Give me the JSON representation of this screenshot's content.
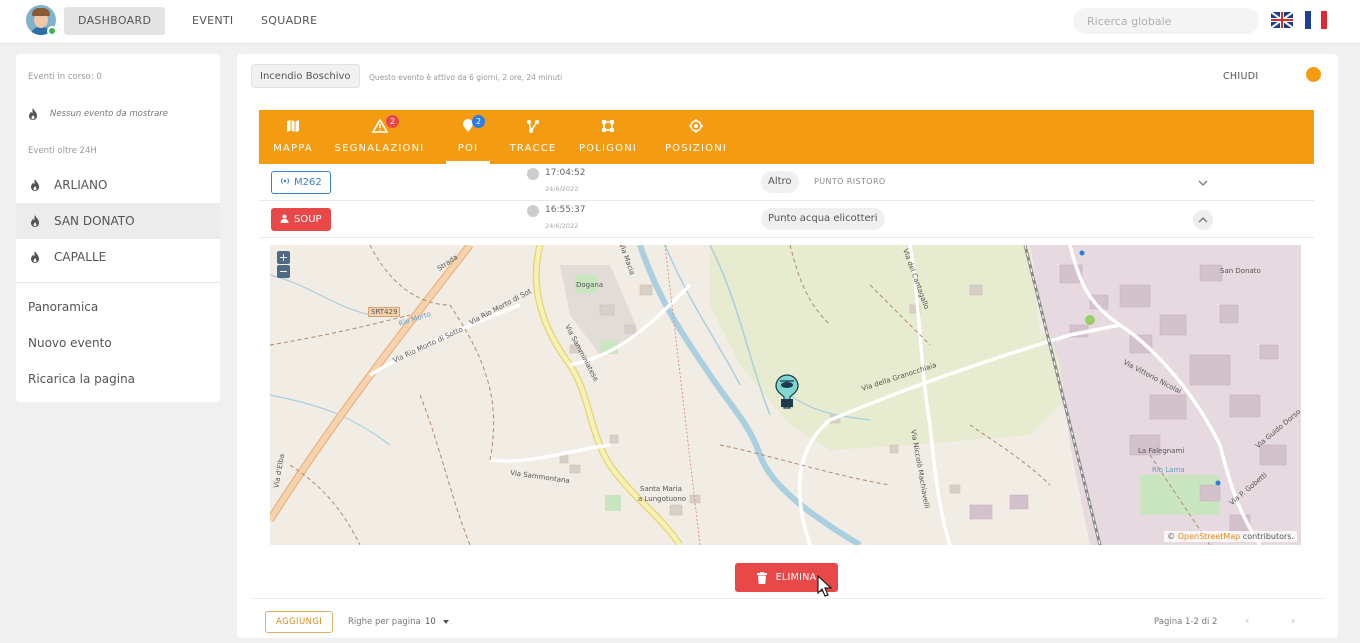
{
  "topnav": {
    "items": [
      {
        "label": "DASHBOARD"
      },
      {
        "label": "EVENTI"
      },
      {
        "label": "SQUADRE"
      }
    ],
    "search_placeholder": "Ricerca globale",
    "languages": [
      "en",
      "fr"
    ]
  },
  "sidebar": {
    "in_progress": "Eventi in corso: 0",
    "no_events": "Nessun evento da mostrare",
    "over_24h": "Eventi oltre 24H",
    "events": [
      {
        "label": "ARLIANO"
      },
      {
        "label": "SAN DONATO"
      },
      {
        "label": "CAPALLE"
      }
    ],
    "links": [
      {
        "label": "Panoramica"
      },
      {
        "label": "Nuovo evento"
      },
      {
        "label": "Ricarica la pagina"
      }
    ]
  },
  "event": {
    "name": "Incendio Boschivo",
    "status": "Questo evento è attivo da 6 giorni, 2 ore, 24 minuti",
    "close_label": "CHIUDI",
    "status_color": "#f39c12"
  },
  "tabs": [
    {
      "label": "MAPPA",
      "icon": "map-icon"
    },
    {
      "label": "SEGNALAZIONI",
      "icon": "warning-icon",
      "badge": "2"
    },
    {
      "label": "POI",
      "icon": "poi-pin-icon",
      "badge": "2"
    },
    {
      "label": "TRACCE",
      "icon": "tracks-icon"
    },
    {
      "label": "POLIGONI",
      "icon": "polygon-icon"
    },
    {
      "label": "POSIZIONI",
      "icon": "target-icon"
    }
  ],
  "poi_rows": [
    {
      "code": "M262",
      "time": "17:04:52",
      "date": "24/6/2022",
      "type": "Altro",
      "subtype": "PUNTO RISTORO",
      "expanded": false
    },
    {
      "code": "SOUP",
      "time": "16:55:37",
      "date": "24/6/2022",
      "type": "Punto acqua elicotteri",
      "subtype": "",
      "expanded": true
    }
  ],
  "map": {
    "labels": {
      "srt": "SRT429",
      "rio_morto": "Rio Morto",
      "via_rio_morto_sotto": "Via Rio Morto di Sotto",
      "via_rio_morto_sot": "Via Rio Morto di Sot",
      "dogana": "Dogana",
      "strada": "Strada",
      "via_macia": "Via Macia",
      "via_sammontana": "Via Sammontana",
      "via_samminiatese": "Via Samminiatese",
      "santa_maria": "Santa Maria",
      "lungotuono": "a Lungotuono",
      "via_granocchiaia": "Via della Granocchiaia",
      "via_cantagallo": "Via del Cantagallo",
      "via_niccolo_machiavelli": "Via Niccolò Machiavelli",
      "via_vittorio_nicolai": "Via Vittorio Nicolai",
      "la_falegnami": "La Falegnami",
      "rio_lama": "Rio Lama",
      "san_donato": "San Donato",
      "via_guido_dorso": "Via Guido Dorso",
      "via_gobetti": "Via P. Gobetti",
      "via_elba": "Via d'Elba",
      "poi_marker": "POI"
    },
    "zoom_in": "+",
    "zoom_out": "−",
    "attribution_prefix": "© ",
    "attribution_link": "OpenStreetMap",
    "attribution_suffix": " contributors."
  },
  "delete_label": "ELIMINA",
  "footer": {
    "add_label": "AGGIUNGI",
    "rows_label": "Righe per pagina",
    "rows_value": "10",
    "page_info": "Pagina 1-2 di 2",
    "prev": "‹",
    "next": "›"
  },
  "colors": {
    "accent": "#f39c12",
    "danger": "#e84848",
    "badge": "#e84848",
    "badge_blue": "#2b7de0",
    "chip_blue": "#3a83c7"
  }
}
